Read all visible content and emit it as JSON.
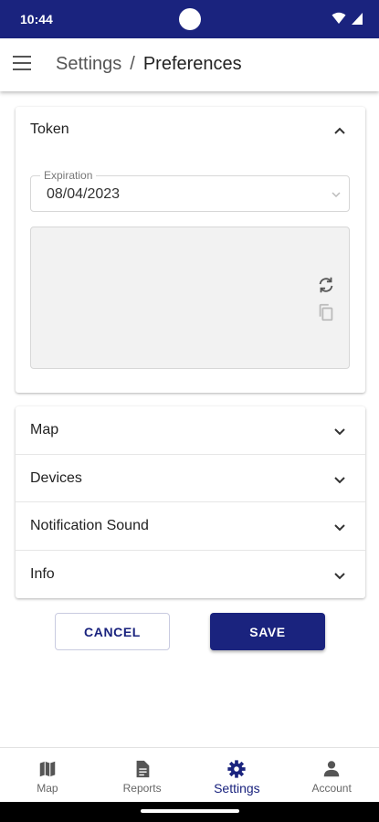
{
  "status_bar": {
    "time": "10:44"
  },
  "header": {
    "breadcrumb": [
      "Settings",
      "Preferences"
    ],
    "separator": "/"
  },
  "token_section": {
    "title": "Token",
    "expiration_label": "Expiration",
    "expiration_value": "08/04/2023",
    "token_value": ""
  },
  "sections": [
    {
      "label": "Map"
    },
    {
      "label": "Devices"
    },
    {
      "label": "Notification Sound"
    },
    {
      "label": "Info"
    }
  ],
  "actions": {
    "cancel_label": "CANCEL",
    "save_label": "SAVE"
  },
  "bottom_nav": [
    {
      "label": "Map",
      "icon": "map-icon",
      "active": false
    },
    {
      "label": "Reports",
      "icon": "description-icon",
      "active": false
    },
    {
      "label": "Settings",
      "icon": "gear-icon",
      "active": true
    },
    {
      "label": "Account",
      "icon": "person-icon",
      "active": false
    }
  ],
  "colors": {
    "primary": "#1a237e",
    "surface": "#ffffff",
    "token_box": "#f2f2f2"
  }
}
